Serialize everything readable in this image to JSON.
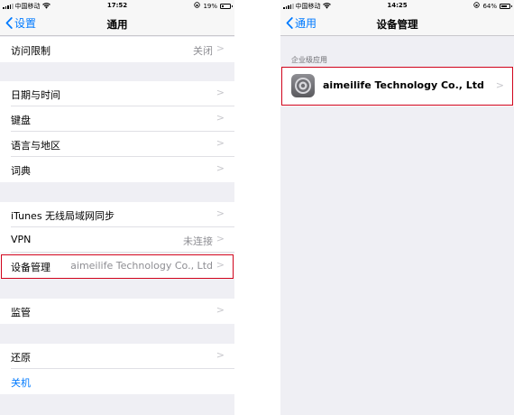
{
  "left": {
    "status": {
      "carrier": "中国移动",
      "time": "17:52",
      "battery": "19%",
      "battery_level": 0.19
    },
    "nav": {
      "back_label": "设置",
      "title": "通用"
    },
    "rows": {
      "restrictions": {
        "label": "访问限制",
        "value": "关闭"
      },
      "date_time": {
        "label": "日期与时间"
      },
      "keyboard": {
        "label": "键盘"
      },
      "language_region": {
        "label": "语言与地区"
      },
      "dictionary": {
        "label": "词典"
      },
      "itunes_wifi_sync": {
        "label": "iTunes 无线局域网同步"
      },
      "vpn": {
        "label": "VPN",
        "value": "未连接"
      },
      "device_management": {
        "label": "设备管理",
        "value": "aimeilife Technology Co., Ltd"
      },
      "supervision": {
        "label": "监管"
      },
      "reset": {
        "label": "还原"
      },
      "shutdown": {
        "label": "关机"
      }
    }
  },
  "right": {
    "status": {
      "carrier": "中国移动",
      "time": "14:25",
      "battery": "64%",
      "battery_level": 0.64
    },
    "nav": {
      "back_label": "通用",
      "title": "设备管理"
    },
    "section_header": "企业级应用",
    "app": {
      "name": "aimeilife Technology Co., Ltd",
      "icon": "settings-gear-icon"
    }
  },
  "colors": {
    "accent": "#007aff",
    "highlight": "#d0021b",
    "background": "#efeff4"
  }
}
